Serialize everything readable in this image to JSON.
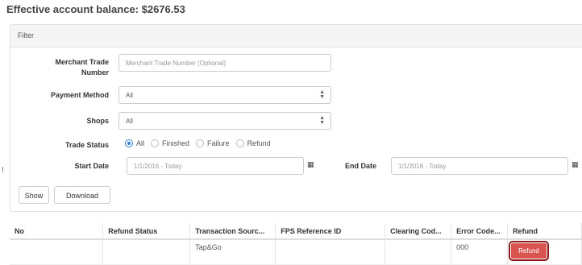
{
  "balance": {
    "label": "Effective account balance: $2676.53"
  },
  "filter": {
    "title": "Filter",
    "merchant_trade_label": "Merchant Trade Number",
    "merchant_trade_placeholder": "Merchant Trade Number (Optional)",
    "payment_method_label": "Payment Method",
    "payment_method_value": "All",
    "shops_label": "Shops",
    "shops_value": "All",
    "trade_status_label": "Trade Status",
    "trade_status_options": [
      "All",
      "Finished",
      "Failure",
      "Refund"
    ],
    "trade_status_selected": "All",
    "start_date_label": "Start Date",
    "start_date_value": "1/1/2016 - Today",
    "end_date_label": "End Date",
    "end_date_value": "1/1/2016 - Today",
    "show_label": "Show",
    "download_label": "Download"
  },
  "edge_mark": "!",
  "table": {
    "columns": [
      "No",
      "Refund Status",
      "Transaction Sourc...",
      "FPS Reference ID",
      "Clearing Cod...",
      "Error Code...",
      "Refund"
    ],
    "rows": [
      {
        "no": "",
        "refund_status": "",
        "transaction_source": "Tap&Go",
        "fps_reference_id": "",
        "clearing_code": "",
        "error_code": "000",
        "refund_button": "Refund"
      }
    ]
  },
  "colors": {
    "radio_selected": "#2a7fd4",
    "refund_button": "#d9534f",
    "refund_outline": "#8b1a1a"
  },
  "icons": {
    "calendar": "calendar-icon",
    "select_caret": "select-caret-icon"
  }
}
